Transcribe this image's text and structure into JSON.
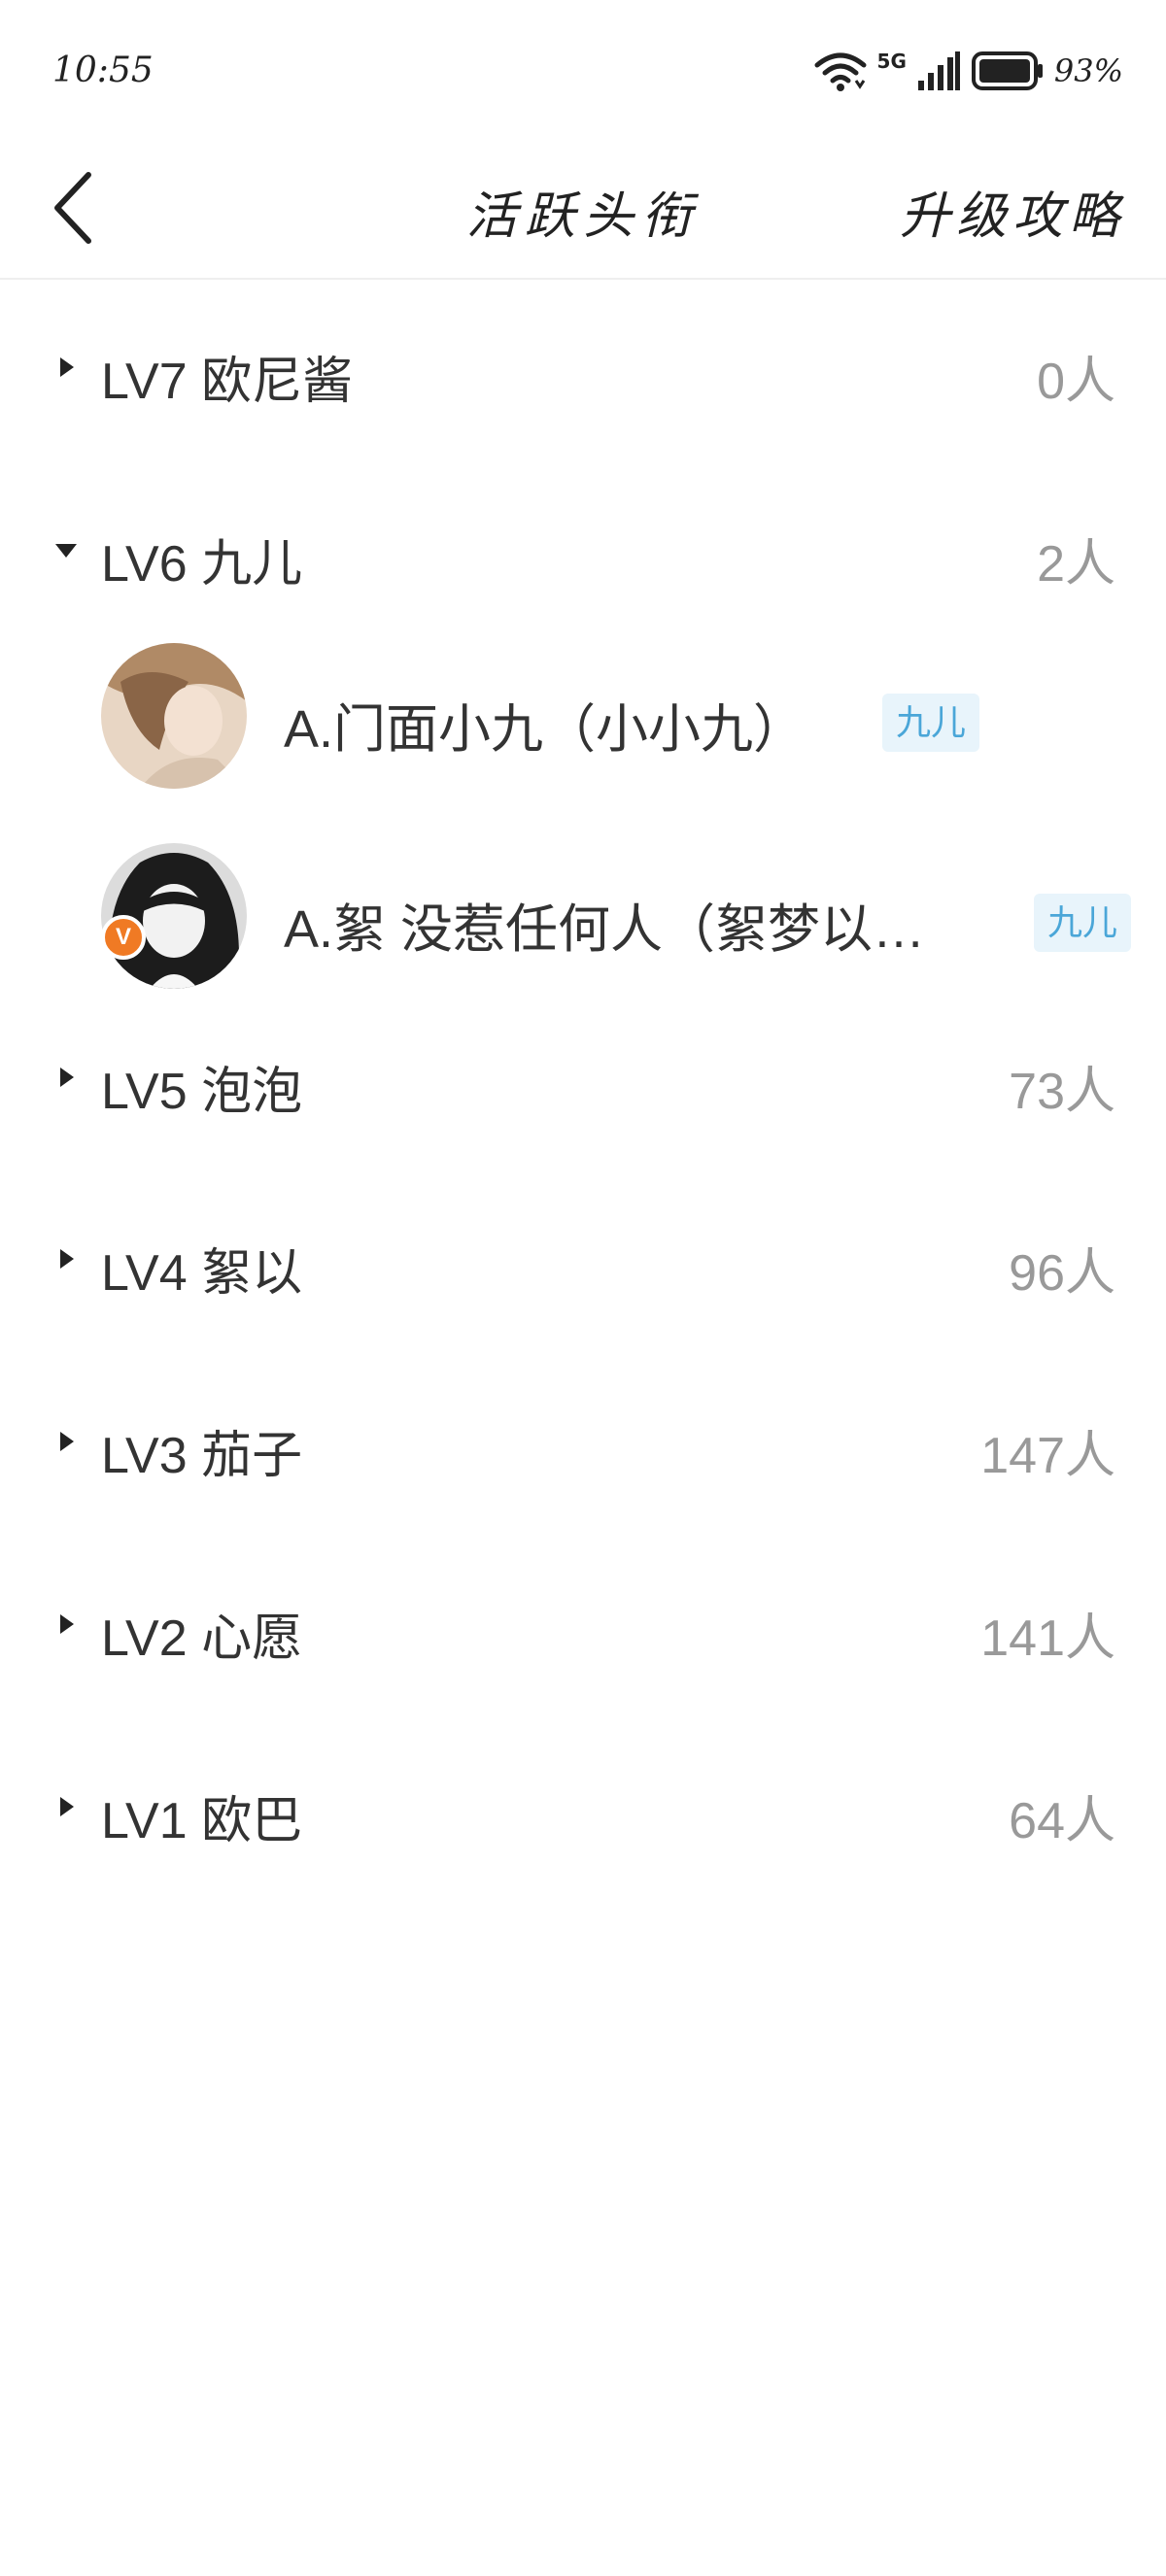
{
  "status_bar": {
    "time": "10:55",
    "network": "5G",
    "battery": "93%",
    "icons": [
      "wifi-icon",
      "signal-icon",
      "battery-icon"
    ]
  },
  "header": {
    "back_icon": "chevron-left-icon",
    "title": "活跃头衔",
    "action": "升级攻略"
  },
  "levels": [
    {
      "name": "LV7 欧尼酱",
      "count": "0人",
      "expanded": false
    },
    {
      "name": "LV6 九儿",
      "count": "2人",
      "expanded": true,
      "members": [
        {
          "name": "A.门面小九（小小九）",
          "tag": "九儿",
          "verified": false
        },
        {
          "name": "A.絮 没惹任何人（絮梦以…",
          "tag": "九儿",
          "verified": true,
          "badge": "V"
        }
      ]
    },
    {
      "name": "LV5 泡泡",
      "count": "73人",
      "expanded": false
    },
    {
      "name": "LV4 絮以",
      "count": "96人",
      "expanded": false
    },
    {
      "name": "LV3 茄子",
      "count": "147人",
      "expanded": false
    },
    {
      "name": "LV2 心愿",
      "count": "141人",
      "expanded": false
    },
    {
      "name": "LV1 欧巴",
      "count": "64人",
      "expanded": false
    }
  ],
  "colors": {
    "tag_bg": "#e8f4fb",
    "tag_text": "#4aa6d8",
    "count_text": "#999999",
    "badge": "#f07a24"
  }
}
